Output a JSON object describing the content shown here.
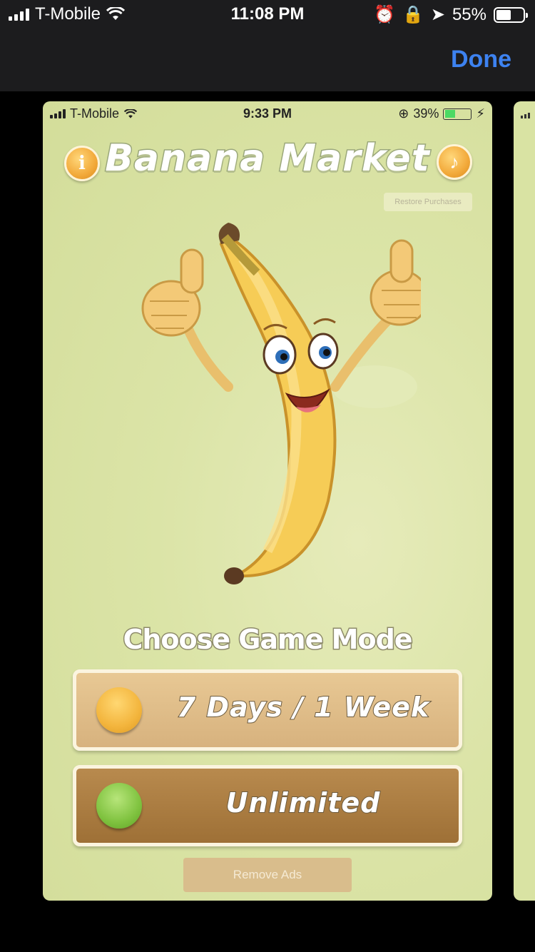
{
  "outer_status": {
    "carrier": "T-Mobile",
    "time": "11:08 PM",
    "battery": "55%",
    "battery_level": 0.55
  },
  "nav": {
    "done_label": "Done"
  },
  "inner_status": {
    "carrier": "T-Mobile",
    "time": "9:33 PM",
    "battery": "39%",
    "battery_level": 0.39
  },
  "game": {
    "title": "Banana Market",
    "info_glyph": "i",
    "music_glyph": "♪",
    "restore_label": "Restore Purchases",
    "choose_mode": "Choose Game Mode",
    "modes": [
      {
        "label": "7 Days / 1 Week",
        "color": "#f3b53d"
      },
      {
        "label": "Unlimited",
        "color": "#7fc23f"
      }
    ],
    "remove_ads": "Remove Ads"
  }
}
